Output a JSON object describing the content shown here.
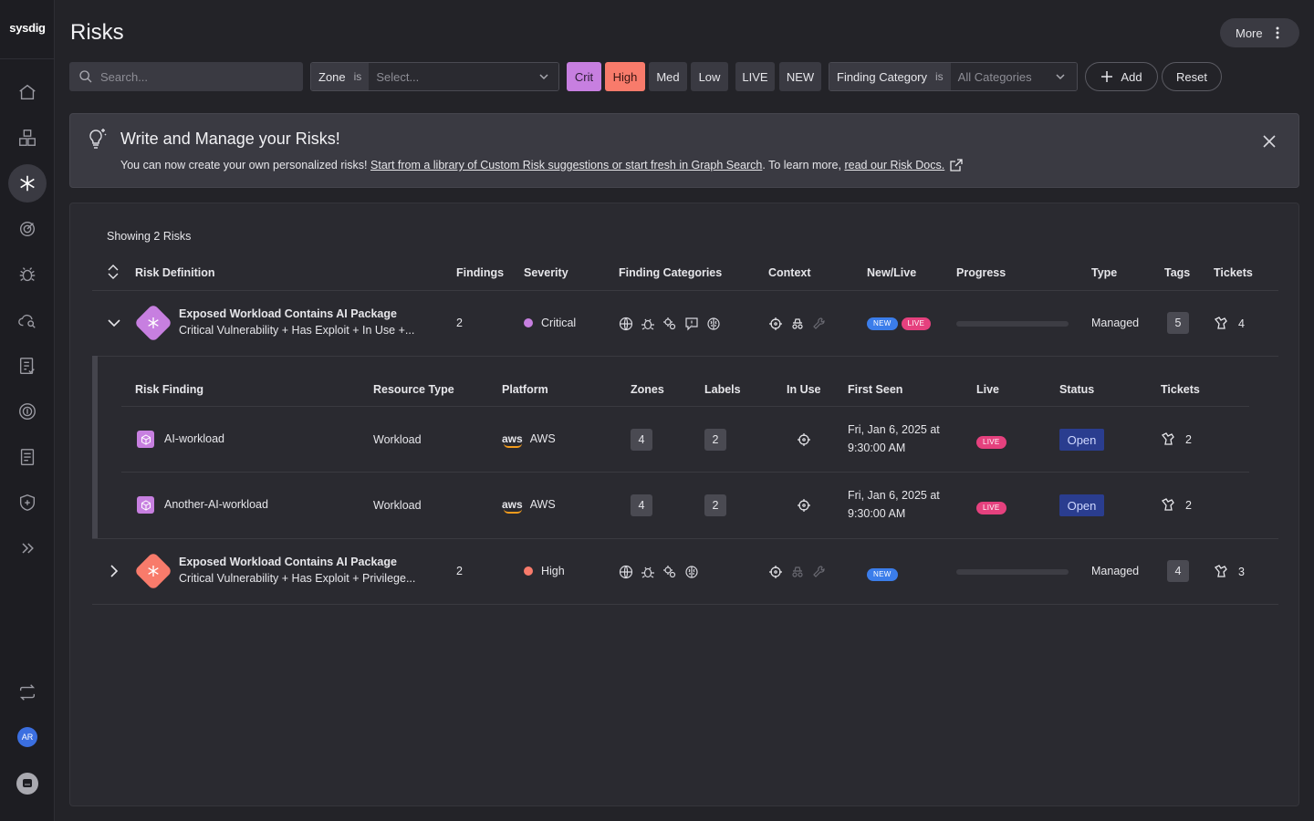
{
  "app": {
    "logo": "sysdig"
  },
  "user": {
    "initials": "AR"
  },
  "header": {
    "title": "Risks",
    "more_label": "More"
  },
  "filters": {
    "search_placeholder": "Search...",
    "zone": {
      "label": "Zone",
      "op": "is",
      "placeholder": "Select..."
    },
    "severity_chips": [
      "Crit",
      "High",
      "Med",
      "Low"
    ],
    "status_chips": [
      "LIVE",
      "NEW"
    ],
    "category": {
      "label": "Finding Category",
      "op": "is",
      "value": "All Categories"
    },
    "add_label": "Add",
    "reset_label": "Reset"
  },
  "banner": {
    "title": "Write and Manage your Risks!",
    "text_before": "You can now create your own personalized risks! ",
    "link1": "Start from a library of Custom Risk suggestions or start fresh in Graph Search",
    "text_middle": ". To learn more, ",
    "link2": "read our Risk Docs."
  },
  "table": {
    "showing": "Showing 2 Risks",
    "columns": [
      "Risk Definition",
      "Findings",
      "Severity",
      "Finding Categories",
      "Context",
      "New/Live",
      "Progress",
      "Type",
      "Tags",
      "Tickets"
    ],
    "rows": [
      {
        "title": "Exposed Workload Contains AI Package",
        "subtitle": "Critical Vulnerability + Has Exploit + In Use +...",
        "findings": "2",
        "severity": "Critical",
        "severity_color": "#c77fe0",
        "new": "NEW",
        "live": "LIVE",
        "type": "Managed",
        "tags": "5",
        "tickets": "4",
        "progress": 0
      },
      {
        "title": "Exposed Workload Contains AI Package",
        "subtitle": "Critical Vulnerability + Has Exploit + Privilege...",
        "findings": "2",
        "severity": "High",
        "severity_color": "#f87b6b",
        "new": "NEW",
        "type": "Managed",
        "tags": "4",
        "tickets": "3",
        "progress": 0
      }
    ]
  },
  "findings": {
    "columns": [
      "Risk Finding",
      "Resource Type",
      "Platform",
      "Zones",
      "Labels",
      "In Use",
      "First Seen",
      "Live",
      "Status",
      "Tickets"
    ],
    "rows": [
      {
        "name": "AI-workload",
        "resource_type": "Workload",
        "platform_logo": "aws",
        "platform": "AWS",
        "zones": "4",
        "labels": "2",
        "first_seen_1": "Fri, Jan 6, 2025 at",
        "first_seen_2": "9:30:00 AM",
        "live": "LIVE",
        "status": "Open",
        "tickets": "2"
      },
      {
        "name": "Another-AI-workload",
        "resource_type": "Workload",
        "platform_logo": "aws",
        "platform": "AWS",
        "zones": "4",
        "labels": "2",
        "first_seen_1": "Fri, Jan 6, 2025 at",
        "first_seen_2": "9:30:00 AM",
        "live": "LIVE",
        "status": "Open",
        "tickets": "2"
      }
    ]
  }
}
